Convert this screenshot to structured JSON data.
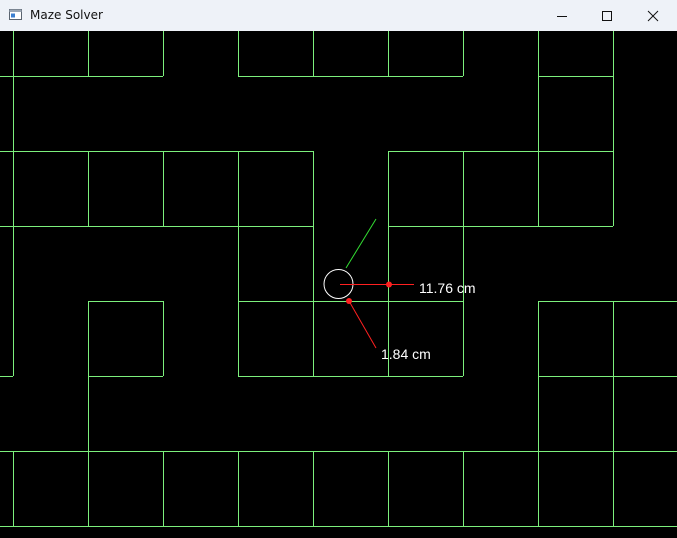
{
  "window": {
    "title": "Maze Solver",
    "app_icon": "window-icon",
    "controls": [
      "minimize-icon",
      "maximize-icon",
      "close-icon"
    ]
  },
  "maze": {
    "wall_color": "#7CF07C",
    "robot_color": "#ffffff",
    "heading_color": "#33dd33",
    "sensor_color": "#ff2020"
  },
  "sensors": {
    "front": {
      "label": "11.76 cm"
    },
    "side": {
      "label": "1.84 cm"
    }
  }
}
